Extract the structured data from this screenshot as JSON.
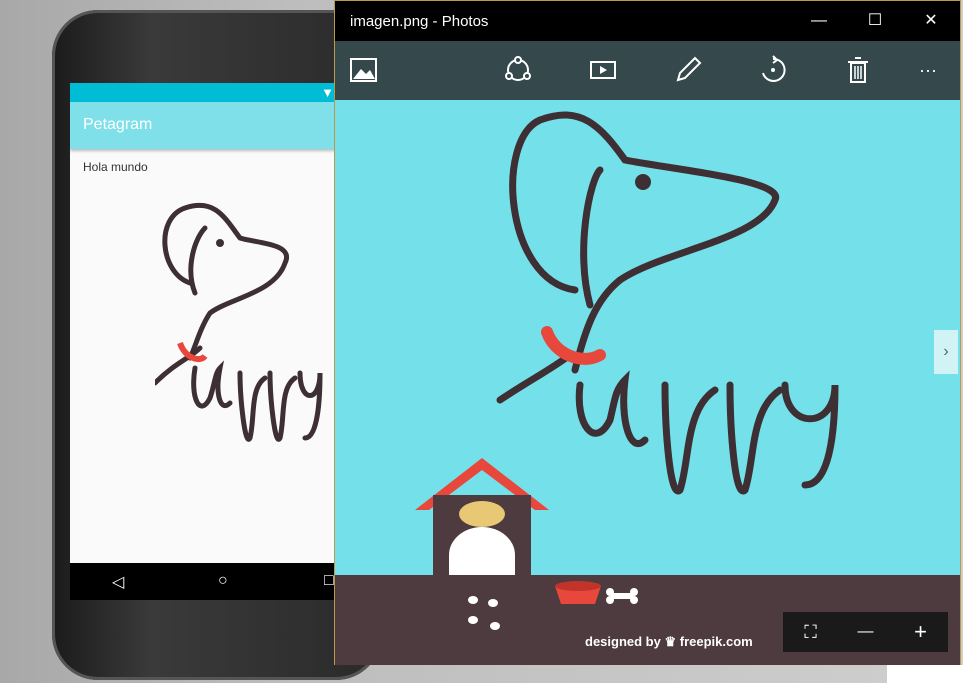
{
  "emulator": {
    "app_title": "Petagram",
    "body_text": "Hola mundo",
    "nav": {
      "back_icon": "triangle-back-icon",
      "home_icon": "circle-home-icon",
      "recent_icon": "square-recent-icon"
    },
    "status_icon": "wifi-icon"
  },
  "photos_window": {
    "title": "imagen.png - Photos",
    "controls": {
      "minimize": "—",
      "maximize": "☐",
      "close": "✕"
    },
    "toolbar": {
      "icons": [
        "image-icon",
        "share-icon",
        "slideshow-icon",
        "edit-icon",
        "rotate-icon",
        "delete-icon",
        "more-icon"
      ],
      "more_label": "···"
    },
    "image": {
      "logo_text": "uppy",
      "credit_prefix": "designed by",
      "credit_brand": "freepik.com"
    },
    "zoom": {
      "fit_label": "⛶",
      "zoom_out_label": "—",
      "zoom_in_label": "+"
    },
    "next_label": "›"
  },
  "colors": {
    "status_bar": "#00bcd4",
    "app_bar": "#7fe0ea",
    "toolbar": "#35494c",
    "image_bg": "#74e0e9",
    "ground": "#4d3b3f",
    "accent_red": "#e8473c",
    "dog_line": "#3d2f33"
  }
}
